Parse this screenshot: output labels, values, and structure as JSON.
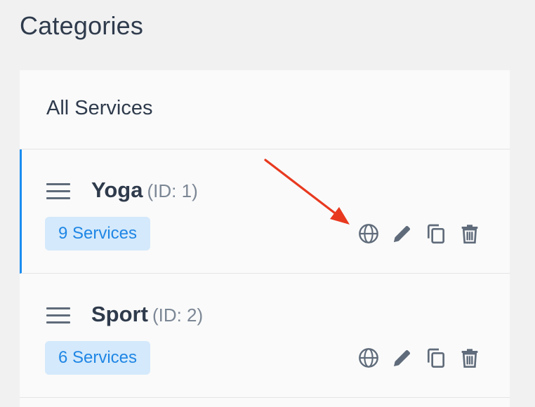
{
  "page": {
    "title": "Categories"
  },
  "panel": {
    "all_services_label": "All Services"
  },
  "categories": [
    {
      "name": "Yoga",
      "id_label": "(ID: 1)",
      "services_badge": "9 Services",
      "selected": true
    },
    {
      "name": "Sport",
      "id_label": "(ID: 2)",
      "services_badge": "6 Services",
      "selected": false
    }
  ],
  "icons": {
    "drag": "drag-handle-icon",
    "translate": "globe-icon",
    "edit": "pencil-icon",
    "duplicate": "copy-icon",
    "delete": "trash-icon"
  },
  "colors": {
    "accent": "#1a8cf0",
    "badge_bg": "#d4e9fb",
    "badge_text": "#1f86e5",
    "annotation_arrow": "#e8391f"
  }
}
